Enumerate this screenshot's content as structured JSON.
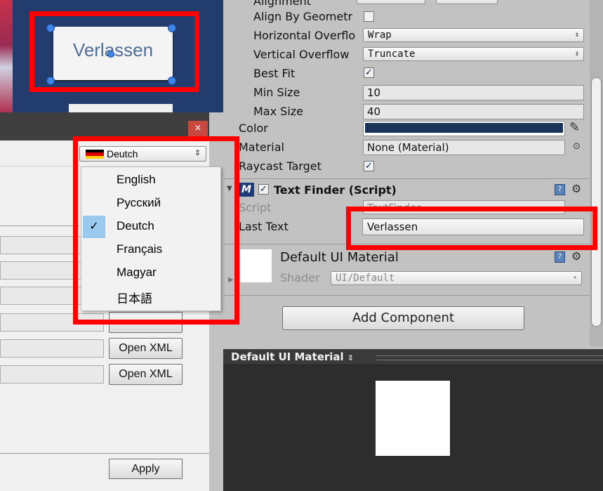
{
  "scene": {
    "button_label": "Verlassen"
  },
  "dialog": {
    "close_glyph": "×",
    "language_select": {
      "value": "Deutch",
      "arrow": "⇕"
    },
    "language_menu": [
      {
        "label": "English",
        "selected": false
      },
      {
        "label": "Русский",
        "selected": false
      },
      {
        "label": "Deutch",
        "selected": true
      },
      {
        "label": "Français",
        "selected": false
      },
      {
        "label": "Magyar",
        "selected": false
      },
      {
        "label": "日本語",
        "selected": false
      }
    ],
    "check_glyph": "✓",
    "open_xml_buttons": [
      "Open XML",
      "Open XML",
      "Open XML"
    ],
    "apply_label": "Apply"
  },
  "inspector": {
    "alignment_label": "Alignment",
    "align_by_geometry_label": "Align By Geometr",
    "horizontal_overflow_label": "Horizontal Overflo",
    "horizontal_overflow_value": "Wrap",
    "vertical_overflow_label": "Vertical Overflow",
    "vertical_overflow_value": "Truncate",
    "best_fit_label": "Best Fit",
    "best_fit_checked": true,
    "min_size_label": "Min Size",
    "min_size_value": "10",
    "max_size_label": "Max Size",
    "max_size_value": "40",
    "color_label": "Color",
    "color_value": "#1b3359",
    "material_label": "Material",
    "material_value": "None (Material)",
    "raycast_label": "Raycast Target",
    "raycast_checked": true,
    "check_glyph": "✓",
    "popup_arrow": "⇕",
    "text_finder": {
      "title": "Text Finder (Script)",
      "script_label": "Script",
      "script_value": "TextFinder",
      "last_text_label": "Last Text",
      "last_text_value": "Verlassen"
    },
    "material_section": {
      "title": "Default UI Material",
      "shader_label": "Shader",
      "shader_value": "UI/Default"
    },
    "add_component_label": "Add Component"
  },
  "preview": {
    "title": "Default UI Material",
    "title_arrow": "⇕"
  }
}
